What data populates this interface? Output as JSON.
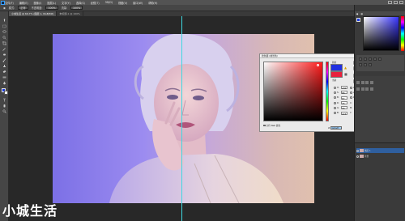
{
  "menu": [
    "文件(F)",
    "编辑(E)",
    "图像(I)",
    "图层(L)",
    "文字(Y)",
    "选择(S)",
    "滤镜(T)",
    "3D(D)",
    "视图(V)",
    "窗口(W)",
    "帮助(H)"
  ],
  "options": {
    "mode_label": "模式:",
    "mode_value": "正常",
    "opacity_label": "不透明度:",
    "opacity_value": "100%",
    "flow_label": "流量:",
    "flow_value": "100%"
  },
  "tabs": [
    {
      "label": "小城生活 @ 66.7% (图层 1, RGB/8#)",
      "active": true
    },
    {
      "label": "未标题-1 @ 100%",
      "active": false
    }
  ],
  "colors": {
    "foreground": "#1a3adf",
    "background": "#ffffff",
    "guide": "#3fd8e0"
  },
  "picker": {
    "title": "拾色器 (前景色)",
    "new_label": "新的",
    "current_label": "当前",
    "buttons": [
      "确定",
      "取消",
      "添加到色板",
      "颜色库"
    ],
    "fields": [
      {
        "label": "H:",
        "value": "235"
      },
      {
        "label": "S:",
        "value": "88"
      },
      {
        "label": "B:",
        "value": "87"
      },
      {
        "label": "R:",
        "value": "26"
      },
      {
        "label": "G:",
        "value": "58"
      },
      {
        "label": "B:",
        "value": "223"
      }
    ],
    "lab_fields": [
      {
        "label": "L:",
        "value": "36"
      },
      {
        "label": "a:",
        "value": "54"
      },
      {
        "label": "b:",
        "value": "-85"
      },
      {
        "label": "C:",
        "value": "89"
      },
      {
        "label": "M:",
        "value": "75"
      },
      {
        "label": "Y:",
        "value": "0"
      }
    ],
    "web_only_label": "只有 Web 颜色",
    "hex_label": "#",
    "hex_value": "1a3adf"
  },
  "layers": [
    {
      "label": "图层 1",
      "selected": true
    },
    {
      "label": "背景",
      "selected": false
    }
  ],
  "watermark": "小城生活"
}
